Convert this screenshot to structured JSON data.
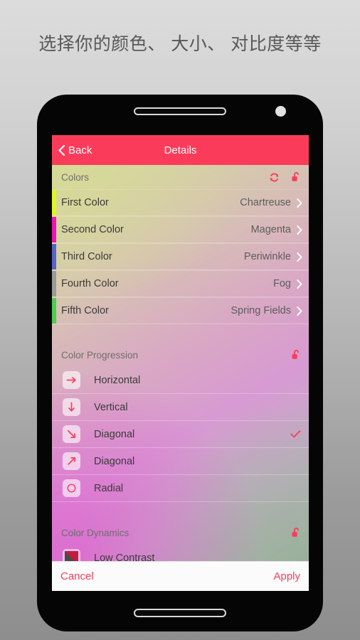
{
  "caption": "选择你的颜色、 大小、 对比度等等",
  "theme": {
    "accent": "#fa3c5a",
    "navbar_bg": "#fa3c5a",
    "navbar_text": "#ffffff",
    "toolbar_bg": "#fbfbfb",
    "page_bg_top": "#dcdcdc",
    "page_bg_bottom": "#8e8e8e"
  },
  "phone": {
    "earpiece": "earpiece-speaker",
    "camera": "front-camera",
    "bottom_speaker": "bottom-speaker"
  },
  "navbar": {
    "back_label": "Back",
    "title": "Details"
  },
  "colors_section": {
    "title": "Colors",
    "shuffle_icon": "refresh-icon",
    "lock_icon": "unlock-icon",
    "rows": [
      {
        "label": "First Color",
        "value": "Chartreuse",
        "swatch": "#e0f520"
      },
      {
        "label": "Second Color",
        "value": "Magenta",
        "swatch": "#ef14b6"
      },
      {
        "label": "Third Color",
        "value": "Periwinkle",
        "swatch": "#5a63c8"
      },
      {
        "label": "Fourth Color",
        "value": "Fog",
        "swatch": "#9a9a9a"
      },
      {
        "label": "Fifth Color",
        "value": "Spring Fields",
        "swatch": "#4fcc52"
      }
    ]
  },
  "progression_section": {
    "title": "Color Progression",
    "lock_icon": "unlock-icon",
    "rows": [
      {
        "label": "Horizontal",
        "icon": "arrow-right-icon",
        "selected": false
      },
      {
        "label": "Vertical",
        "icon": "arrow-down-icon",
        "selected": false
      },
      {
        "label": "Diagonal",
        "icon": "arrow-down-right-icon",
        "selected": true
      },
      {
        "label": "Diagonal",
        "icon": "arrow-up-right-icon",
        "selected": false
      },
      {
        "label": "Radial",
        "icon": "circle-icon",
        "selected": false
      }
    ]
  },
  "dynamics_section": {
    "title": "Color Dynamics",
    "lock_icon": "unlock-icon",
    "rows": [
      {
        "label": "Low Contrast",
        "icon": "contrast-swatch-icon"
      }
    ]
  },
  "toolbar": {
    "cancel_label": "Cancel",
    "apply_label": "Apply"
  }
}
